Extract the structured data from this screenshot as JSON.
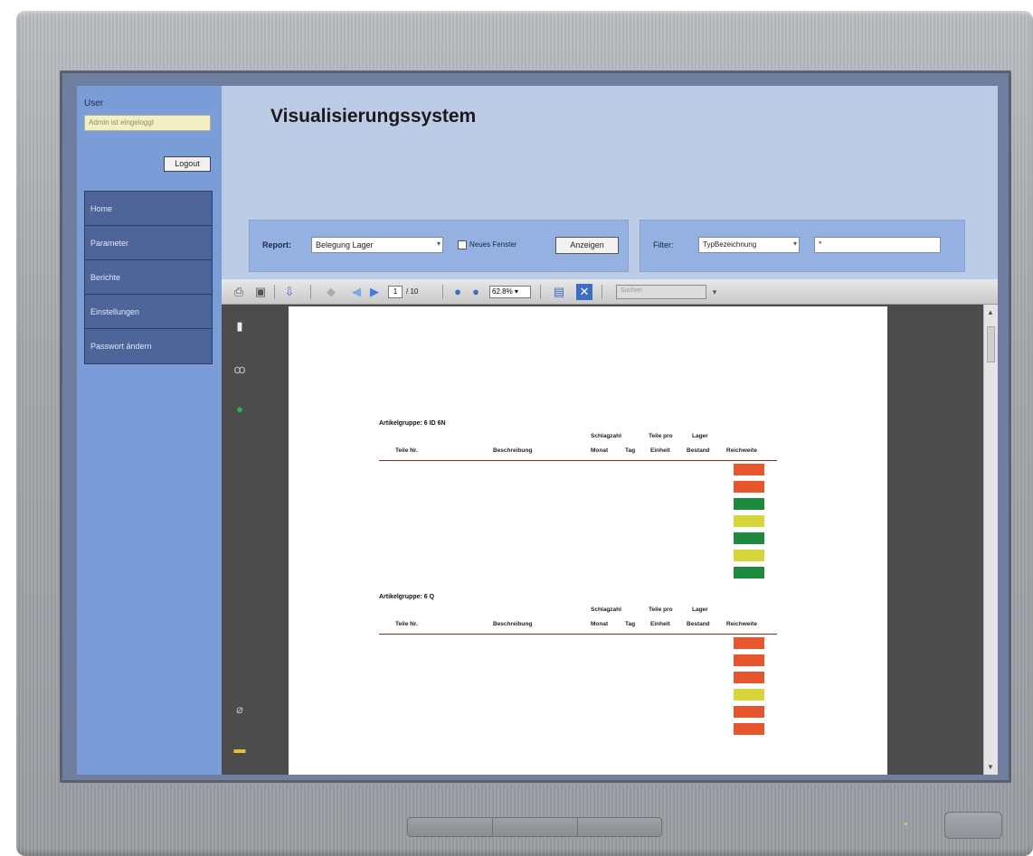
{
  "app": {
    "title": "Visualisierungssystem"
  },
  "sidebar": {
    "user_label": "User",
    "user_value": "Admin ist eingeloggt",
    "logout_label": "Logout",
    "items": [
      {
        "label": "Home"
      },
      {
        "label": "Parameter"
      },
      {
        "label": "Berichte"
      },
      {
        "label": "Einstellungen"
      },
      {
        "label": "Passwort ändern"
      }
    ]
  },
  "report_bar": {
    "report_label": "Report:",
    "report_value": "Belegung Lager",
    "new_window_label": "Neues Fenster",
    "new_window_checked": false,
    "show_button": "Anzeigen"
  },
  "filter_bar": {
    "filter_label": "Filter:",
    "filter_field": "TypBezeichnung",
    "filter_value": "*"
  },
  "viewer_toolbar": {
    "current_page": "1",
    "page_count": "/ 10",
    "zoom": "62.8%",
    "search_placeholder": "Suchen",
    "icons": [
      "print-icon",
      "save-icon",
      "export-icon",
      "first-page-icon",
      "next-page-icon",
      "zoom-out-icon",
      "zoom-in-icon",
      "page-layout-icon",
      "fit-page-icon"
    ]
  },
  "report": {
    "columns": {
      "teile_nr": "Teile Nr.",
      "beschreibung": "Beschreibung",
      "schlagzahl_top": "Schlagzahl",
      "schlagzahl_monat": "Monat",
      "tag": "Tag",
      "teile_pro_top": "Teile pro",
      "einheit": "Einheit",
      "lager_top": "Lager",
      "bestand": "Bestand",
      "reichweite": "Reichweite"
    },
    "groups": [
      {
        "title": "Artikelgruppe: 6 ID 6N",
        "reichweite": [
          "red",
          "red",
          "green",
          "yellow",
          "green",
          "yellow",
          "green"
        ]
      },
      {
        "title": "Artikelgruppe: 6 Q",
        "reichweite": [
          "red",
          "red",
          "red",
          "yellow",
          "red",
          "red"
        ]
      }
    ]
  },
  "colors": {
    "red": "#e8562d",
    "green": "#1e8a3e",
    "yellow": "#d6d63a"
  }
}
